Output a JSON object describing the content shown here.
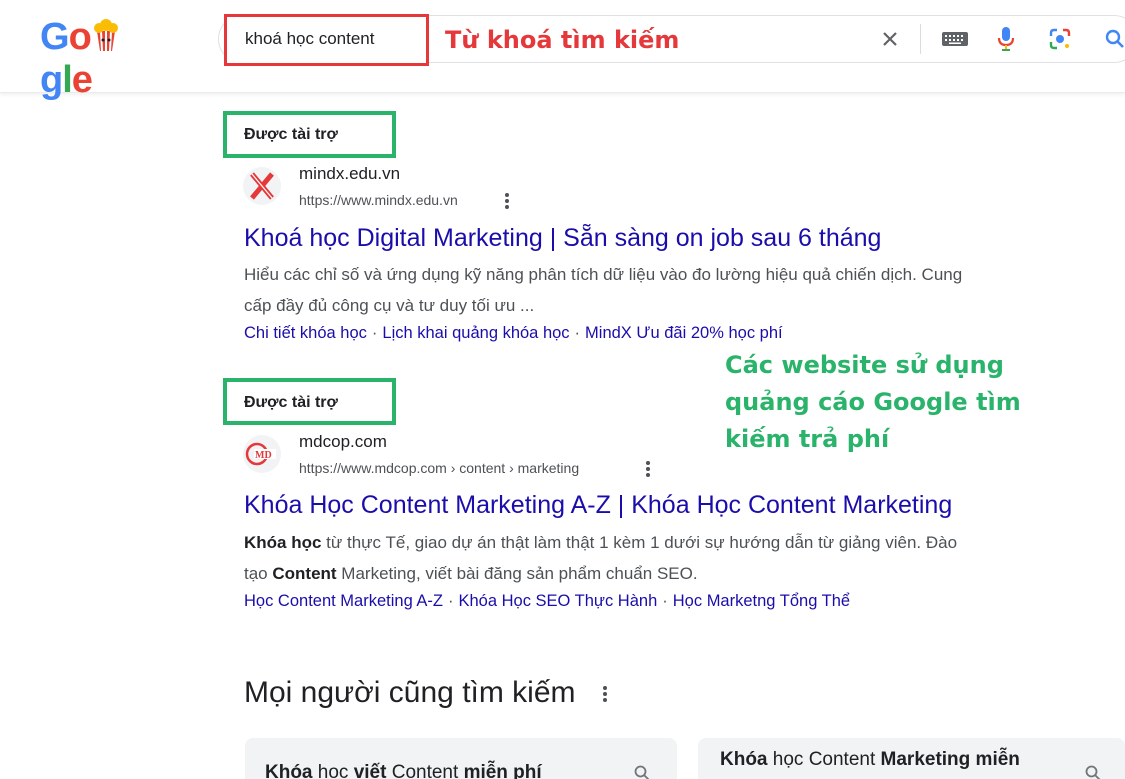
{
  "search": {
    "query": "khoá học content",
    "annotation": "Từ khoá tìm kiếm"
  },
  "ads": [
    {
      "sponsored_label": "Được tài trợ",
      "site_name": "mindx.edu.vn",
      "site_url": "https://www.mindx.edu.vn",
      "title": "Khoá học Digital Marketing | Sẵn sàng on job sau 6 tháng",
      "snippet_line1": "Hiểu các chỉ số và ứng dụng kỹ năng phân tích dữ liệu vào đo lường hiệu quả chiến dịch. Cung",
      "snippet_line2": "cấp đầy đủ công cụ và tư duy tối ưu ...",
      "sitelinks": [
        "Chi tiết khóa học",
        "Lịch khai quảng khóa học",
        "MindX Ưu đãi 20% học phí"
      ]
    },
    {
      "sponsored_label": "Được tài trợ",
      "site_name": "mdcop.com",
      "site_url": "https://www.mdcop.com › content › marketing",
      "title": "Khóa Học Content Marketing A-Z | Khóa Học Content Marketing",
      "snippet_b1": "Khóa học",
      "snippet_r1": " từ thực Tế, giao dự án thật làm thật 1 kèm 1 dưới sự hướng dẫn từ giảng viên. Đào",
      "snippet_r2": "tạo ",
      "snippet_b2": "Content",
      "snippet_r3": " Marketing, viết bài đăng sản phẩm chuẩn SEO.",
      "sitelinks": [
        "Học Content Marketing A-Z",
        "Khóa Học SEO Thực Hành",
        "Học Marketng Tổng Thể"
      ]
    }
  ],
  "annotation_green": {
    "line1": "Các website sử dụng",
    "line2": "quảng cáo Google tìm",
    "line3": "kiếm trả phí"
  },
  "people_also_search": {
    "title": "Mọi người cũng tìm kiếm",
    "chips": [
      {
        "b1": "Khóa",
        "r1": " học ",
        "b2": "viết",
        "r2": " Content ",
        "b3": "miễn phí"
      },
      {
        "b1": "Khóa",
        "r1": " học Content ",
        "b2": "Marketing miễn",
        "r2": "",
        "b3": ""
      }
    ]
  },
  "colors": {
    "link_blue": "#1a0dab",
    "annotation_red": "#e5383b",
    "annotation_green": "#2ab36a"
  },
  "icons": [
    "clear-icon",
    "keyboard-icon",
    "microphone-icon",
    "lens-icon",
    "search-icon",
    "more-options-icon"
  ]
}
